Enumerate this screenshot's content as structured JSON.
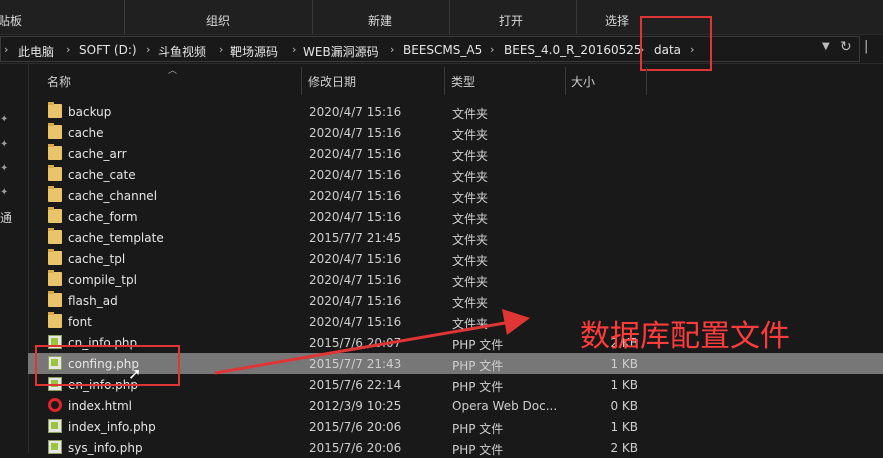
{
  "ribbon": {
    "left_partial": "贴板",
    "groups": [
      "组织",
      "新建",
      "打开",
      "选择"
    ]
  },
  "address_bar": {
    "crumbs": [
      "此电脑",
      "SOFT (D:)",
      "斗鱼视频",
      "靶场源码",
      "WEB漏洞源码",
      "BEESCMS_A5",
      "BEES_4.0_R_20160525",
      "data"
    ],
    "dropdown_icon": "chevron-down-icon",
    "refresh_icon": "refresh-icon"
  },
  "columns": {
    "name": "名称",
    "date": "修改日期",
    "type": "类型",
    "size": "大小"
  },
  "files": [
    {
      "icon": "folder",
      "name": "backup",
      "date": "2020/4/7 15:16",
      "type": "文件夹",
      "size": ""
    },
    {
      "icon": "folder",
      "name": "cache",
      "date": "2020/4/7 15:16",
      "type": "文件夹",
      "size": ""
    },
    {
      "icon": "folder",
      "name": "cache_arr",
      "date": "2020/4/7 15:16",
      "type": "文件夹",
      "size": ""
    },
    {
      "icon": "folder",
      "name": "cache_cate",
      "date": "2020/4/7 15:16",
      "type": "文件夹",
      "size": ""
    },
    {
      "icon": "folder",
      "name": "cache_channel",
      "date": "2020/4/7 15:16",
      "type": "文件夹",
      "size": ""
    },
    {
      "icon": "folder",
      "name": "cache_form",
      "date": "2020/4/7 15:16",
      "type": "文件夹",
      "size": ""
    },
    {
      "icon": "folder",
      "name": "cache_template",
      "date": "2015/7/7 21:45",
      "type": "文件夹",
      "size": ""
    },
    {
      "icon": "folder",
      "name": "cache_tpl",
      "date": "2020/4/7 15:16",
      "type": "文件夹",
      "size": ""
    },
    {
      "icon": "folder",
      "name": "compile_tpl",
      "date": "2020/4/7 15:16",
      "type": "文件夹",
      "size": ""
    },
    {
      "icon": "folder",
      "name": "flash_ad",
      "date": "2020/4/7 15:16",
      "type": "文件夹",
      "size": ""
    },
    {
      "icon": "folder",
      "name": "font",
      "date": "2020/4/7 15:16",
      "type": "文件夹",
      "size": ""
    },
    {
      "icon": "php",
      "name": "cn_info.php",
      "date": "2015/7/6 20:07",
      "type": "PHP 文件",
      "size": "2 KB"
    },
    {
      "icon": "php",
      "name": "confing.php",
      "date": "2015/7/7 21:43",
      "type": "PHP 文件",
      "size": "1 KB"
    },
    {
      "icon": "php",
      "name": "en_info.php",
      "date": "2015/7/6 22:14",
      "type": "PHP 文件",
      "size": "1 KB"
    },
    {
      "icon": "opera",
      "name": "index.html",
      "date": "2012/3/9 10:25",
      "type": "Opera Web Doc...",
      "size": "0 KB"
    },
    {
      "icon": "php",
      "name": "index_info.php",
      "date": "2015/7/6 20:06",
      "type": "PHP 文件",
      "size": "1 KB"
    },
    {
      "icon": "php",
      "name": "sys_info.php",
      "date": "2015/7/6 20:06",
      "type": "PHP 文件",
      "size": "2 KB"
    }
  ],
  "selected_file": "confing.php",
  "annotation": {
    "text": "数据库配置文件",
    "color": "#ff3b3b"
  },
  "nav_partial_label": "通"
}
